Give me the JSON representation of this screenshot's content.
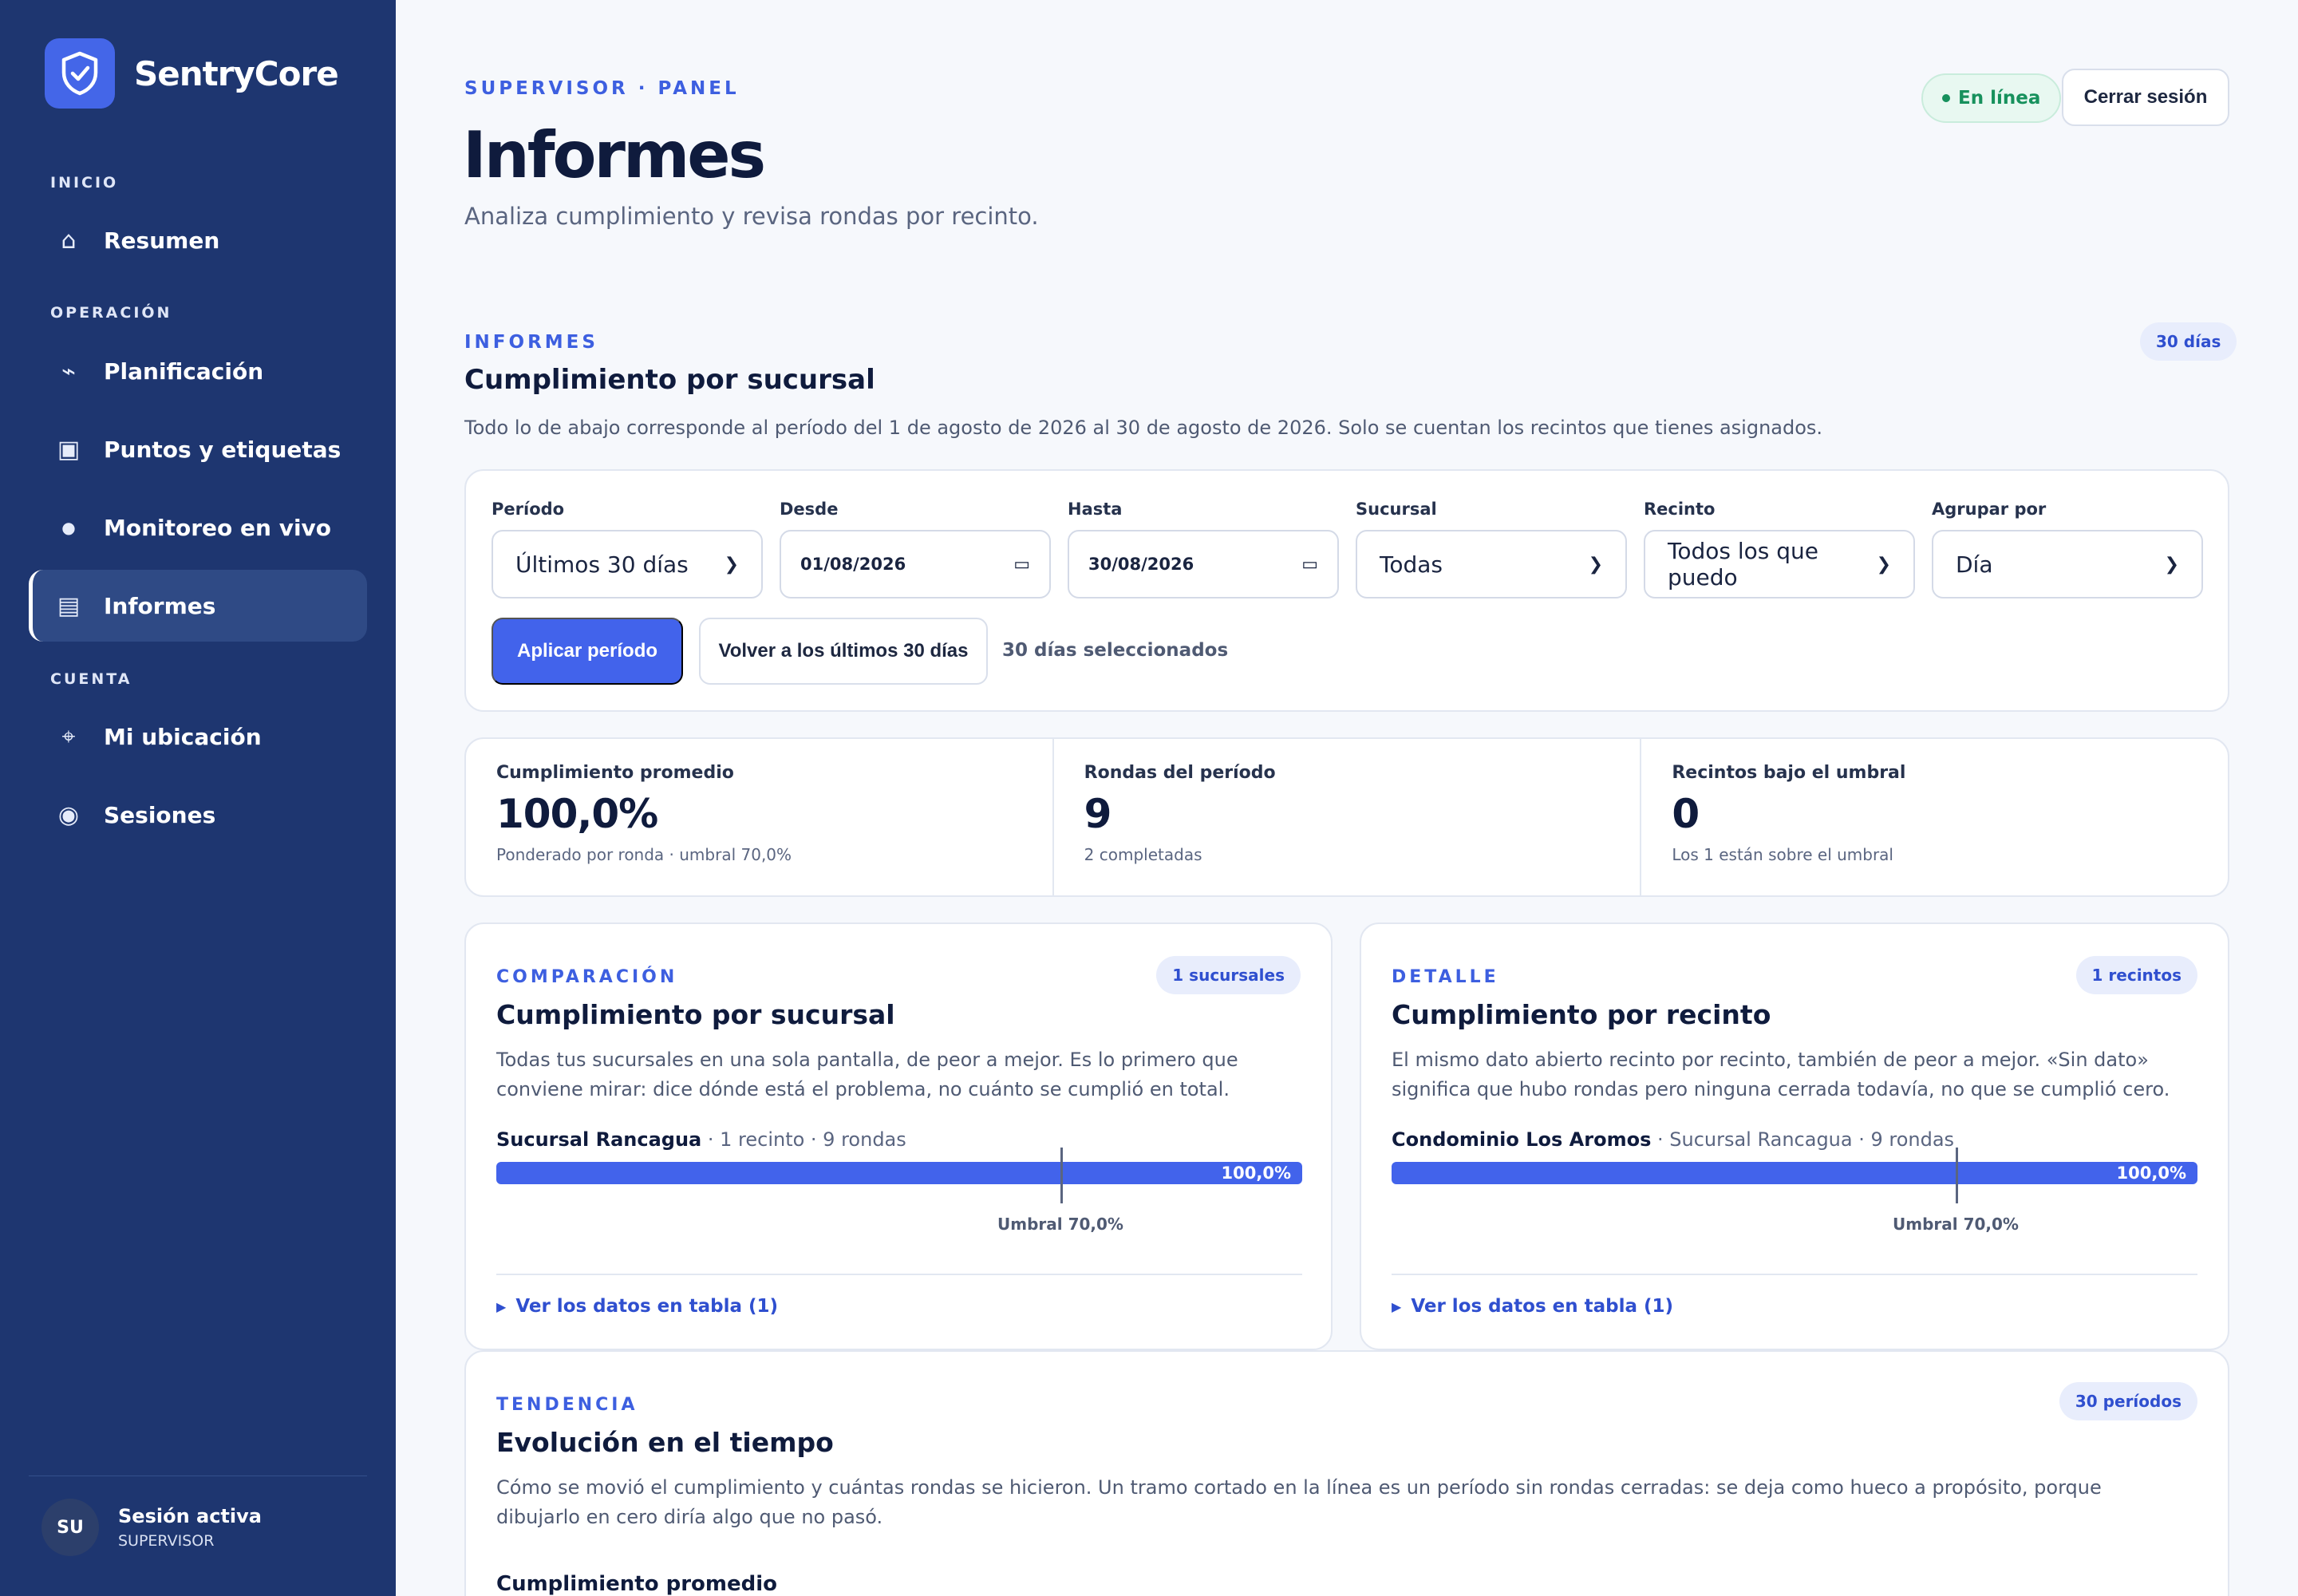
{
  "brand": {
    "name": "SentryCore",
    "logo_icon": "shield-check-icon"
  },
  "sidebar": {
    "sections": [
      {
        "label": "INICIO",
        "items": [
          {
            "label": "Resumen",
            "icon": "⌂",
            "icon_name": "home-icon"
          }
        ]
      },
      {
        "label": "OPERACIÓN",
        "items": [
          {
            "label": "Planificación",
            "icon": "⌁",
            "icon_name": "route-icon"
          },
          {
            "label": "Puntos y etiquetas",
            "icon": "▣",
            "icon_name": "tag-icon"
          },
          {
            "label": "Monitoreo en vivo",
            "icon": "●",
            "icon_name": "live-dot-icon"
          },
          {
            "label": "Informes",
            "icon": "▤",
            "icon_name": "report-icon",
            "active": true
          }
        ]
      },
      {
        "label": "CUENTA",
        "items": [
          {
            "label": "Mi ubicación",
            "icon": "⌖",
            "icon_name": "location-icon"
          },
          {
            "label": "Sesiones",
            "icon": "◉",
            "icon_name": "sessions-icon"
          }
        ]
      }
    ],
    "session": {
      "initials": "SU",
      "title": "Sesión activa",
      "role": "SUPERVISOR"
    }
  },
  "header": {
    "eyebrow": "SUPERVISOR · PANEL",
    "title": "Informes",
    "subtitle": "Analiza cumplimiento y revisa rondas por recinto.",
    "status": "En línea",
    "logout": "Cerrar sesión"
  },
  "section": {
    "eyebrow": "INFORMES",
    "title": "Cumplimiento por sucursal",
    "badge": "30 días",
    "description": "Todo lo de abajo corresponde al período del 1 de agosto de 2026 al 30 de agosto de 2026. Solo se cuentan los recintos que tienes asignados."
  },
  "filters": {
    "fields": [
      {
        "label": "Período",
        "value": "Últimos 30 días",
        "kind": "select"
      },
      {
        "label": "Desde",
        "value": "01/08/2026",
        "kind": "date"
      },
      {
        "label": "Hasta",
        "value": "30/08/2026",
        "kind": "date"
      },
      {
        "label": "Sucursal",
        "value": "Todas",
        "kind": "select"
      },
      {
        "label": "Recinto",
        "value": "Todos los que puedo",
        "kind": "select"
      },
      {
        "label": "Agrupar por",
        "value": "Día",
        "kind": "select"
      }
    ],
    "apply": "Aplicar período",
    "reset": "Volver a los últimos 30 días",
    "selected_note": "30 días seleccionados"
  },
  "kpis": [
    {
      "label": "Cumplimiento promedio",
      "value": "100,0%",
      "sub": "Ponderado por ronda · umbral 70,0%"
    },
    {
      "label": "Rondas del período",
      "value": "9",
      "sub": "2 completadas"
    },
    {
      "label": "Recintos bajo el umbral",
      "value": "0",
      "sub": "Los 1 están sobre el umbral"
    }
  ],
  "comparison": {
    "eyebrow": "COMPARACIÓN",
    "title": "Cumplimiento por sucursal",
    "badge": "1 sucursales",
    "description": "Todas tus sucursales en una sola pantalla, de peor a mejor. Es lo primero que conviene mirar: dice dónde está el problema, no cuánto se cumplió en total.",
    "bar": {
      "name": "Sucursal Rancagua",
      "meta": " · 1 recinto · 9 rondas",
      "value_label": "100,0%",
      "fraction": 1.0
    },
    "threshold": {
      "label": "Umbral 70,0%",
      "fraction": 0.7
    },
    "table_toggle": "Ver los datos en tabla (1)"
  },
  "detail": {
    "eyebrow": "DETALLE",
    "title": "Cumplimiento por recinto",
    "badge": "1 recintos",
    "description": "El mismo dato abierto recinto por recinto, también de peor a mejor. «Sin dato» significa que hubo rondas pero ninguna cerrada todavía, no que se cumplió cero.",
    "bar": {
      "name": "Condominio Los Aromos",
      "meta": " · Sucursal Rancagua · 9 rondas",
      "value_label": "100,0%",
      "fraction": 1.0
    },
    "threshold": {
      "label": "Umbral 70,0%",
      "fraction": 0.7
    },
    "table_toggle": "Ver los datos en tabla (1)"
  },
  "trend": {
    "eyebrow": "TENDENCIA",
    "title": "Evolución en el tiempo",
    "badge": "30 períodos",
    "description": "Cómo se movió el cumplimiento y cuántas rondas se hicieron. Un tramo cortado en la línea es un período sin rondas cerradas: se deja como hueco a propósito, porque dibujarlo en cero diría algo que no pasó.",
    "subtitle": "Cumplimiento promedio"
  },
  "colors": {
    "sidebar": "#1e3670",
    "accent": "#4263eb",
    "online": "#17915d"
  }
}
